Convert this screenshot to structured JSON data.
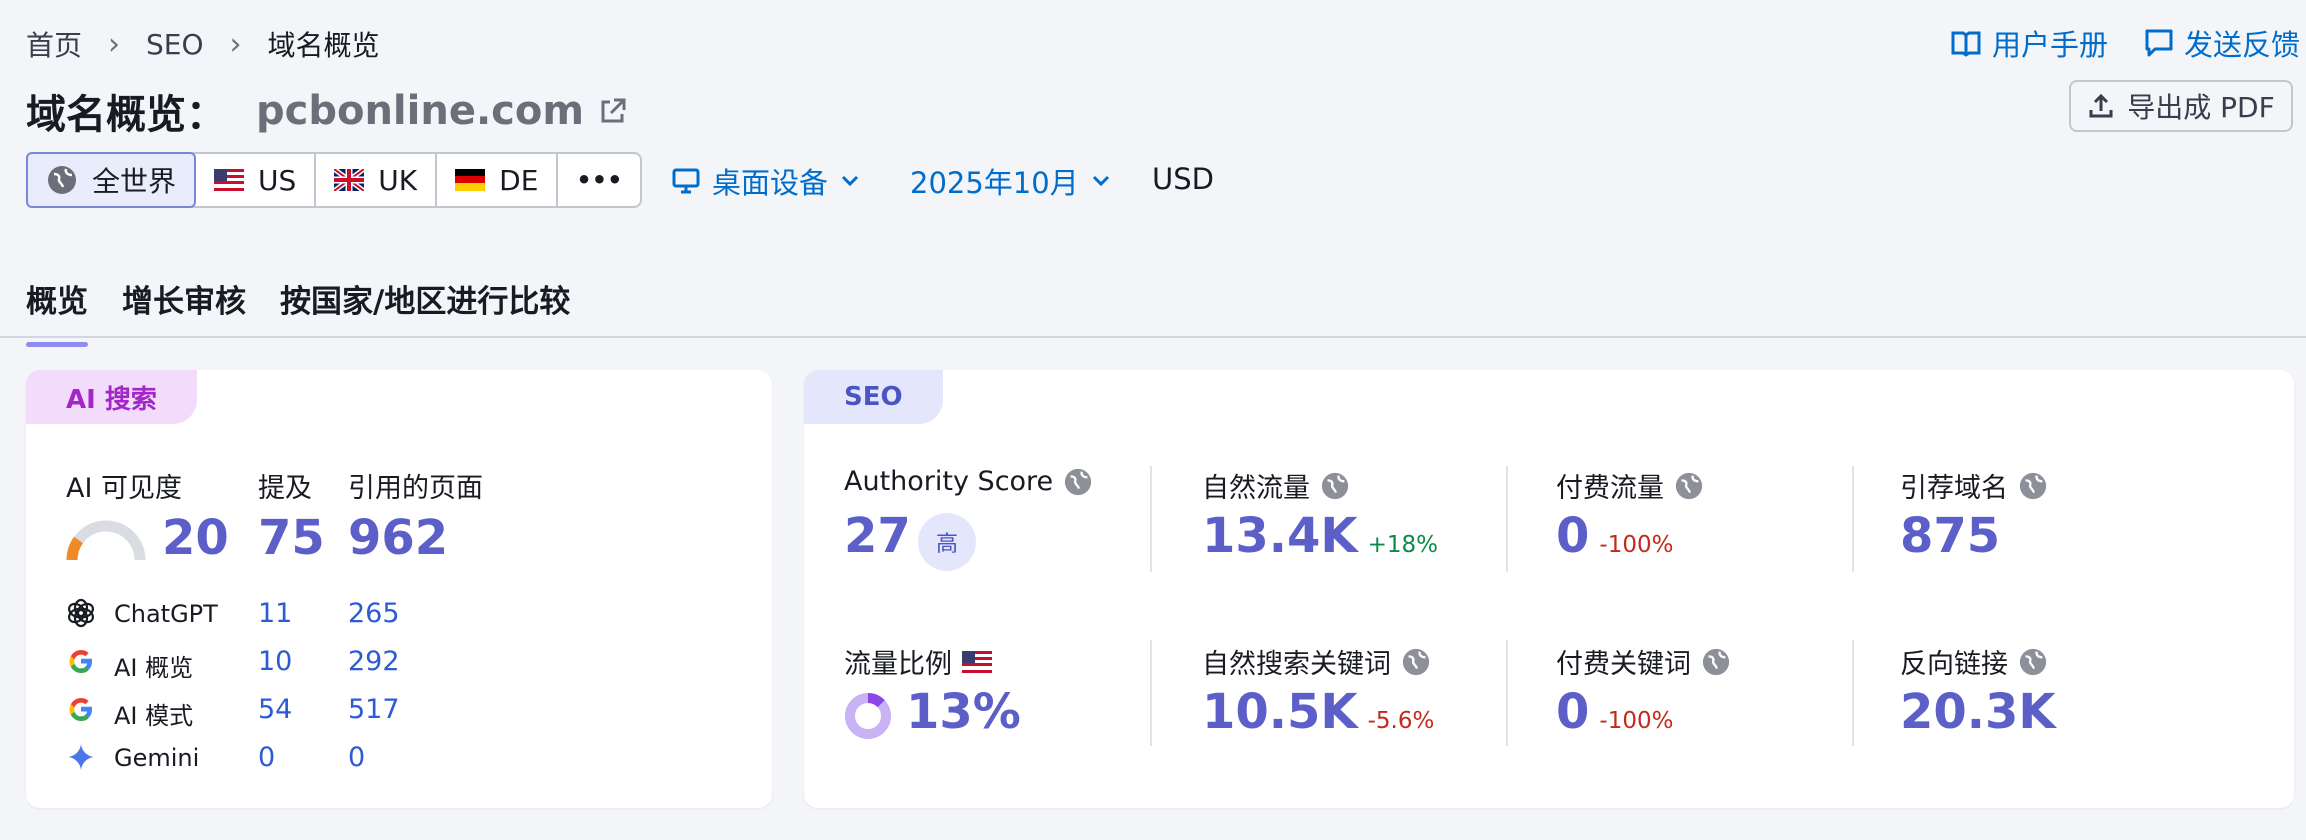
{
  "breadcrumb": [
    "首页",
    "SEO",
    "域名概览"
  ],
  "header": {
    "title": "域名概览：",
    "domain": "pcbonline.com",
    "manual_label": "用户手册",
    "feedback_label": "发送反馈",
    "export_label": "导出成 PDF"
  },
  "database": {
    "items": [
      {
        "label": "全世界",
        "icon": "globe-icon"
      },
      {
        "label": "US",
        "icon": "us-flag-icon"
      },
      {
        "label": "UK",
        "icon": "uk-flag-icon"
      },
      {
        "label": "DE",
        "icon": "de-flag-icon"
      }
    ],
    "more": "•••",
    "device_label": "桌面设备",
    "date_label": "2025年10月",
    "currency": "USD"
  },
  "tabs": [
    "概览",
    "增长审核",
    "按国家/地区进行比较"
  ],
  "ai_card": {
    "tag": "AI 搜索",
    "visibility_label": "AI 可见度",
    "visibility_value": "20",
    "visibility_fraction": 0.2,
    "mentions_label": "提及",
    "mentions_value": "75",
    "cited_label": "引用的页面",
    "cited_value": "962",
    "rows": [
      {
        "name": "ChatGPT",
        "icon": "chatgpt-icon",
        "mentions": "11",
        "cited": "265"
      },
      {
        "name": "AI 概览",
        "icon": "google-icon",
        "mentions": "10",
        "cited": "292"
      },
      {
        "name": "AI 模式",
        "icon": "google-icon",
        "mentions": "54",
        "cited": "517"
      },
      {
        "name": "Gemini",
        "icon": "gemini-icon",
        "mentions": "0",
        "cited": "0"
      }
    ]
  },
  "seo_card": {
    "tag": "SEO",
    "authority_label": "Authority Score",
    "authority_value": "27",
    "authority_badge": "高",
    "organic_label": "自然流量",
    "organic_value": "13.4K",
    "organic_delta": "+18%",
    "paid_label": "付费流量",
    "paid_value": "0",
    "paid_delta": "-100%",
    "ref_label": "引荐域名",
    "ref_value": "875",
    "share_label": "流量比例",
    "share_value": "13%",
    "share_fraction": 0.13,
    "orgkw_label": "自然搜索关键词",
    "orgkw_value": "10.5K",
    "orgkw_delta": "-5.6%",
    "paidkw_label": "付费关键词",
    "paidkw_value": "0",
    "paidkw_delta": "-100%",
    "backlinks_label": "反向链接",
    "backlinks_value": "20.3K"
  },
  "colors": {
    "accent": "#5b5fc7",
    "link": "#006dca",
    "positive": "#0d8a4a",
    "negative": "#c4291b",
    "ai_tag_bg": "#f3dcfb",
    "seo_tag_bg": "#e4e6fb"
  }
}
